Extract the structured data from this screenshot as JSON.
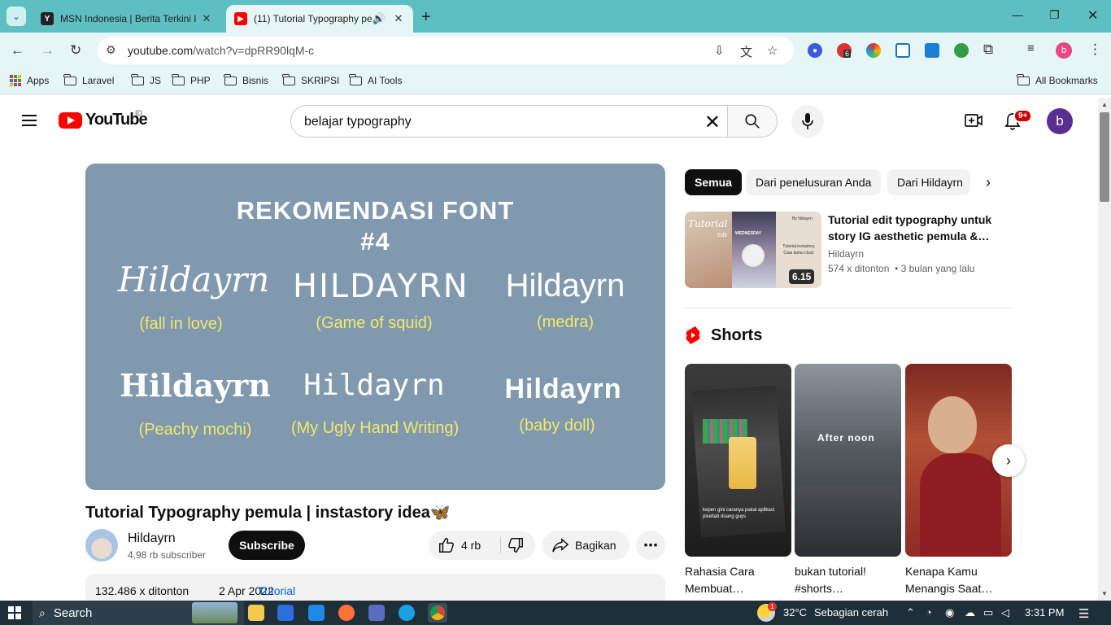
{
  "browser": {
    "tabs": [
      {
        "title": "MSN Indonesia | Berita Terkini I",
        "icon": "msn-favicon",
        "favicon_letter": "Y"
      },
      {
        "title": "(11) Tutorial Typography pe",
        "icon": "youtube-favicon",
        "audio": "speaker-icon"
      }
    ],
    "url_host": "youtube.com",
    "url_path": "/watch?v=dpRR90lqM-c",
    "extension_badge": "6"
  },
  "bookmarks": {
    "apps": "Apps",
    "items": [
      "Laravel",
      "JS",
      "PHP",
      "Bisnis",
      "SKRIPSI",
      "AI Tools"
    ],
    "all": "All Bookmarks"
  },
  "youtube": {
    "logo_text": "YouTube",
    "country": "ID",
    "search_query": "belajar typography",
    "notif_count": "9+",
    "avatar_letter": "b"
  },
  "video": {
    "thumbnail": {
      "heading1": "REKOMENDASI FONT",
      "heading2": "#4",
      "samples": [
        {
          "text": "Hildayrn",
          "caption": "(fall in love)"
        },
        {
          "text": "HILDAYRN",
          "caption": "(Game of squid)"
        },
        {
          "text": "Hildayrn",
          "caption": "(medra)"
        },
        {
          "text": "Hildayrn",
          "caption": "(Peachy mochi)"
        },
        {
          "text": "Hildayrn",
          "caption": "(My Ugly Hand Writing)"
        },
        {
          "text": "Hildayrn",
          "caption": "(baby doll)"
        }
      ]
    },
    "title": "Tutorial Typography pemula | instastory idea",
    "title_emoji": "🦋",
    "channel": "Hildayrn",
    "subscribers": "4,98 rb subscriber",
    "subscribe_label": "Subscribe",
    "likes": "4 rb",
    "share_label": "Bagikan",
    "views": "132.486 x ditonton",
    "date": "2 Apr 2022",
    "tag": "Tutorial"
  },
  "sidebar": {
    "chips": [
      "Semua",
      "Dari penelusuran Anda",
      "Dari Hildayrn"
    ],
    "recommended": {
      "title": "Tutorial edit typography untuk story IG aesthetic pemula &…",
      "channel": "Hildayrn",
      "views": "574 x ditonton",
      "age": "3 bulan yang lalu",
      "duration": "6.15",
      "thumb_texts": [
        "Tutorial",
        "Edit",
        "WEDNESDAY",
        "By hildayrn",
        "Tutorial instastory",
        "Cara kamu cluck"
      ]
    },
    "shorts_heading": "Shorts",
    "shorts": [
      {
        "title": "Rahasia Cara Membuat…",
        "overlay": "kepen gini caranya pakai aplikasi pixellab doang guys"
      },
      {
        "title": "bukan tutorial! #shorts…",
        "overlay": "After noon"
      },
      {
        "title": "Kenapa Kamu Menangis Saat…",
        "overlay": ""
      }
    ]
  },
  "taskbar": {
    "search_label": "Search",
    "temperature": "32°C",
    "weather": "Sebagian cerah",
    "time": "3:31 PM",
    "weather_badge": "1"
  }
}
